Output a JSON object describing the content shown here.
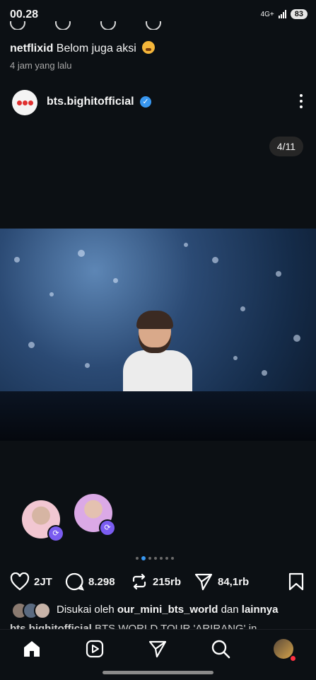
{
  "status_bar": {
    "time": "00.28",
    "network": "4G+",
    "battery": "83"
  },
  "previous_comment": {
    "user": "netflixid",
    "text": "Belom juga aksi",
    "time": "4 jam yang lalu"
  },
  "post": {
    "username": "bts.bighitofficial",
    "verified": true,
    "counter": "4/11",
    "likes": "2JT",
    "comments": "8.298",
    "reposts": "215rb",
    "shares": "84,1rb",
    "liked_by_prefix": "Disukai oleh",
    "liked_by_user": "our_mini_bts_world",
    "liked_by_conj": "dan",
    "liked_by_others": "lainnya",
    "caption_user": "bts.bighitofficial",
    "caption_text": "BTS WORLD TOUR 'ARIRANG' in ..."
  },
  "colors": {
    "background": "#0c1014",
    "accent": "#3897f0",
    "story_badge": "#7a5cf0"
  },
  "icons": {
    "like": "heart-icon",
    "comment": "comment-icon",
    "repost": "repost-icon",
    "share": "send-icon",
    "save": "bookmark-icon",
    "home": "home-icon",
    "reels": "reels-icon",
    "send": "send-icon",
    "search": "search-icon",
    "profile": "profile-avatar-icon"
  }
}
